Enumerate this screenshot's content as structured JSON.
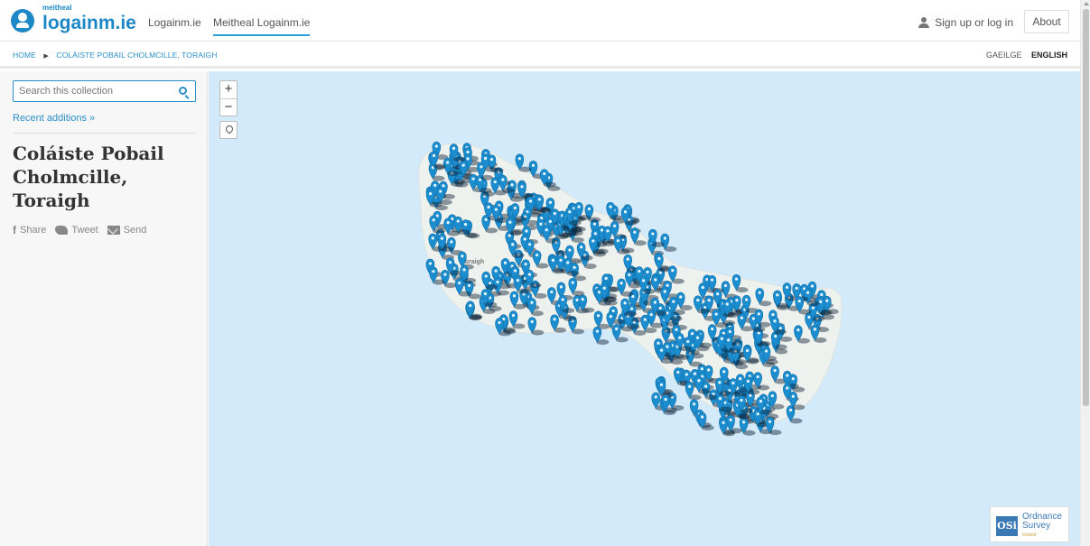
{
  "header": {
    "logo_small": "meitheal",
    "logo_main": "logainm.ie",
    "nav": [
      {
        "label": "Logainm.ie",
        "active": false
      },
      {
        "label": "Meitheal Logainm.ie",
        "active": true
      }
    ],
    "signup_label": "Sign up or log in",
    "about_label": "About"
  },
  "breadcrumb": {
    "home": "HOME",
    "current": "COLÁISTE POBAIL CHOLMCILLE, TORAIGH"
  },
  "language": {
    "irish": "GAEILGE",
    "english": "ENGLISH",
    "active": "ENGLISH"
  },
  "sidebar": {
    "search_placeholder": "Search this collection",
    "recent_label": "Recent additions »",
    "title": "Coláiste Pobail Cholmcille, Toraigh",
    "share": [
      {
        "icon": "facebook-icon",
        "label": "Share"
      },
      {
        "icon": "twitter-icon",
        "label": "Tweet"
      },
      {
        "icon": "mail-icon",
        "label": "Send"
      }
    ]
  },
  "map": {
    "zoom_in": "+",
    "zoom_out": "−",
    "labels": [
      "Toraigh",
      "Toraigh"
    ],
    "marker_color": "#1c8ed0",
    "island_color": "#eef3ef",
    "sea_color": "#d2eaf9",
    "attribution": {
      "badge": "OSi",
      "line1": "Ordnance",
      "line2": "Survey",
      "line3": "Ireland"
    }
  },
  "colors": {
    "accent": "#2a8fc6",
    "logo": "#1e88c7"
  }
}
